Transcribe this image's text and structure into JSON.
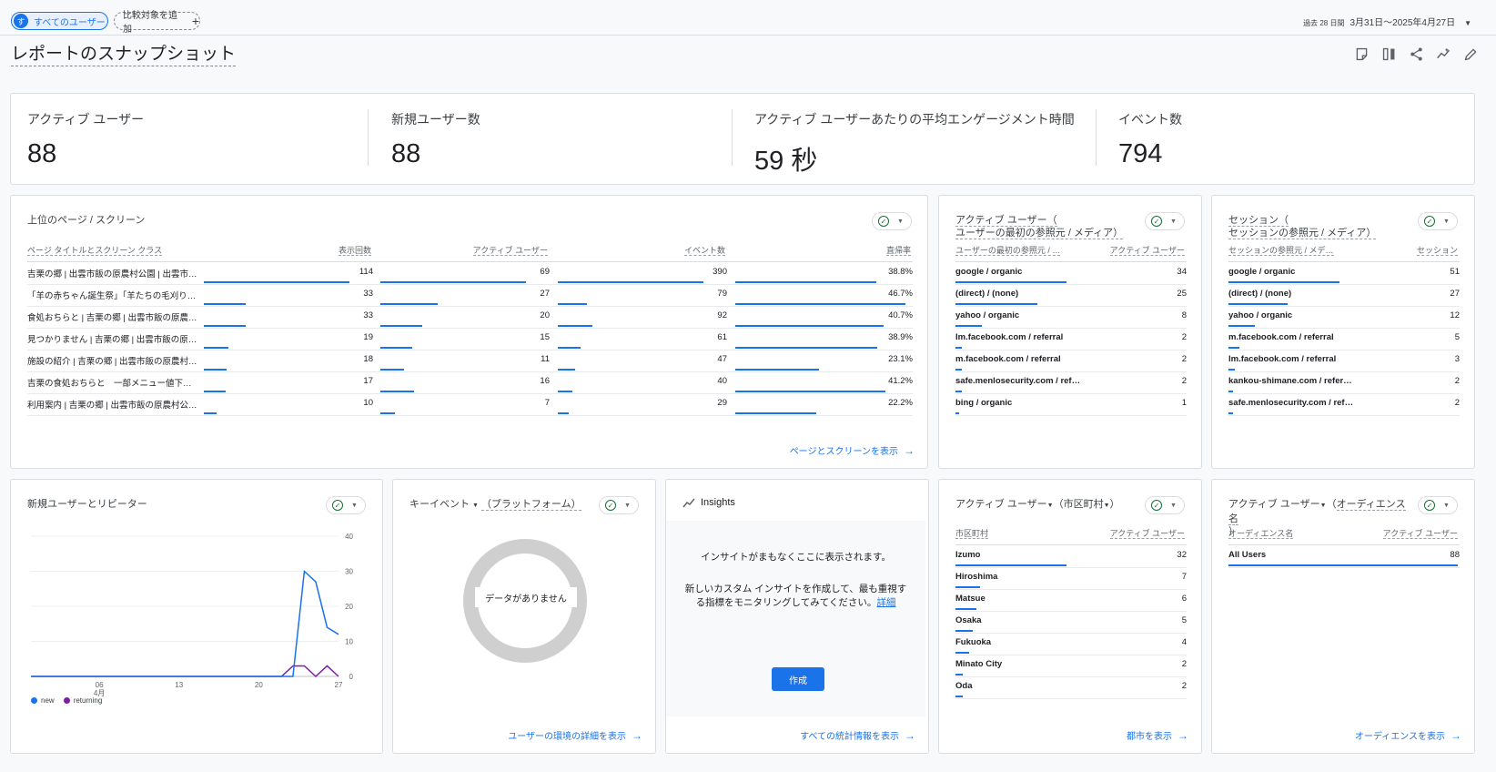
{
  "topbar": {
    "user_chip_avatar": "す",
    "user_chip_label": "すべてのユーザー",
    "add_compare_label": "比較対象を追加",
    "date_prefix": "過去 28 日間",
    "date_range": "3月31日～2025年4月27日",
    "date_caret": "▼"
  },
  "page": {
    "title": "レポートのスナップショット"
  },
  "kpis": [
    {
      "label": "アクティブ ユーザー",
      "value": "88"
    },
    {
      "label": "新規ユーザー数",
      "value": "88"
    },
    {
      "label": "アクティブ ユーザーあたりの平均エンゲージメント時間",
      "value": "59 秒"
    },
    {
      "label": "イベント数",
      "value": "794"
    }
  ],
  "pages_card": {
    "title": "上位のページ / スクリーン",
    "headers": [
      "ページ タイトルとスクリーン クラス",
      "表示回数",
      "アクティブ ユーザー",
      "イベント数",
      "直帰率"
    ],
    "rows": [
      {
        "name": "吉栗の郷 | 出雲市飯の原農村公園 | 出雲市…",
        "views": "114",
        "users": "69",
        "events": "390",
        "bounce": "38.8%",
        "v": 114,
        "u": 69,
        "e": 390,
        "b": 38.8
      },
      {
        "name": "「羊の赤ちゃん誕生祭」「羊たちの毛刈り…",
        "views": "33",
        "users": "27",
        "events": "79",
        "bounce": "46.7%",
        "v": 33,
        "u": 27,
        "e": 79,
        "b": 46.7
      },
      {
        "name": "食処おちらと | 吉栗の郷 | 出雲市飯の原農…",
        "views": "33",
        "users": "20",
        "events": "92",
        "bounce": "40.7%",
        "v": 33,
        "u": 20,
        "e": 92,
        "b": 40.7
      },
      {
        "name": "見つかりません | 吉栗の郷 | 出雲市飯の原…",
        "views": "19",
        "users": "15",
        "events": "61",
        "bounce": "38.9%",
        "v": 19,
        "u": 15,
        "e": 61,
        "b": 38.9
      },
      {
        "name": "施設の紹介 | 吉栗の郷 | 出雲市飯の原農村…",
        "views": "18",
        "users": "11",
        "events": "47",
        "bounce": "23.1%",
        "v": 18,
        "u": 11,
        "e": 47,
        "b": 23.1
      },
      {
        "name": "吉栗の食処おちらと　一部メニュー値下…",
        "views": "17",
        "users": "16",
        "events": "40",
        "bounce": "41.2%",
        "v": 17,
        "u": 16,
        "e": 40,
        "b": 41.2
      },
      {
        "name": "利用案内 | 吉栗の郷 | 出雲市飯の原農村公…",
        "views": "10",
        "users": "7",
        "events": "29",
        "bounce": "22.2%",
        "v": 10,
        "u": 7,
        "e": 29,
        "b": 22.2
      }
    ],
    "link": "ページとスクリーンを表示"
  },
  "source_card": {
    "title_line1": "アクティブ ユーザー（",
    "title_line2": "ユーザーの最初の参照元 / メディア）",
    "headers": [
      "ユーザーの最初の参照元 / …",
      "アクティブ ユーザー"
    ],
    "rows": [
      {
        "name": "google / organic",
        "value": "34",
        "n": 34
      },
      {
        "name": "(direct) / (none)",
        "value": "25",
        "n": 25
      },
      {
        "name": "yahoo / organic",
        "value": "8",
        "n": 8
      },
      {
        "name": "lm.facebook.com / referral",
        "value": "2",
        "n": 2
      },
      {
        "name": "m.facebook.com / referral",
        "value": "2",
        "n": 2
      },
      {
        "name": "safe.menlosecurity.com / ref…",
        "value": "2",
        "n": 2
      },
      {
        "name": "bing / organic",
        "value": "1",
        "n": 1
      }
    ]
  },
  "session_card": {
    "title_line1": "セッション（",
    "title_line2": "セッションの参照元 / メディア）",
    "headers": [
      "セッションの参照元 / メデ…",
      "セッション"
    ],
    "rows": [
      {
        "name": "google / organic",
        "value": "51",
        "n": 51
      },
      {
        "name": "(direct) / (none)",
        "value": "27",
        "n": 27
      },
      {
        "name": "yahoo / organic",
        "value": "12",
        "n": 12
      },
      {
        "name": "m.facebook.com / referral",
        "value": "5",
        "n": 5
      },
      {
        "name": "lm.facebook.com / referral",
        "value": "3",
        "n": 3
      },
      {
        "name": "kankou-shimane.com / refer…",
        "value": "2",
        "n": 2
      },
      {
        "name": "safe.menlosecurity.com / ref…",
        "value": "2",
        "n": 2
      }
    ]
  },
  "newret_card": {
    "title": "新規ユーザーとリピーター",
    "legend": [
      "new",
      "returning"
    ]
  },
  "chart_data": {
    "type": "line",
    "x_ticks": [
      "06",
      "13",
      "20",
      "27"
    ],
    "x_month": "4月",
    "y_ticks": [
      "0",
      "10",
      "20",
      "30",
      "40"
    ],
    "ylim": [
      0,
      40
    ],
    "x": [
      "3/31",
      "4/1",
      "4/2",
      "4/3",
      "4/4",
      "4/5",
      "4/6",
      "4/7",
      "4/8",
      "4/9",
      "4/10",
      "4/11",
      "4/12",
      "4/13",
      "4/14",
      "4/15",
      "4/16",
      "4/17",
      "4/18",
      "4/19",
      "4/20",
      "4/21",
      "4/22",
      "4/23",
      "4/24",
      "4/25",
      "4/26",
      "4/27"
    ],
    "series": [
      {
        "name": "new",
        "color": "#1a73e8",
        "values": [
          0,
          0,
          0,
          0,
          0,
          0,
          0,
          0,
          0,
          0,
          0,
          0,
          0,
          0,
          0,
          0,
          0,
          0,
          0,
          0,
          0,
          0,
          0,
          0,
          30,
          27,
          14,
          12
        ]
      },
      {
        "name": "returning",
        "color": "#7b1fa2",
        "values": [
          0,
          0,
          0,
          0,
          0,
          0,
          0,
          0,
          0,
          0,
          0,
          0,
          0,
          0,
          0,
          0,
          0,
          0,
          0,
          0,
          0,
          0,
          0,
          3,
          3,
          0,
          3,
          0
        ]
      }
    ],
    "grid": true,
    "legend": "bottom-left"
  },
  "keyevent_card": {
    "title_a": "キーイベント",
    "title_b": "（プラットフォーム）",
    "nodata": "データがありません",
    "link": "ユーザーの環境の詳細を表示"
  },
  "insights_card": {
    "title": "Insights",
    "msg1": "インサイトがまもなくここに表示されます。",
    "msg2a": "新しいカスタム インサイトを作成して、最も重視す",
    "msg2b": "る指標をモニタリングしてみてください。",
    "detail_link": "詳細",
    "create_btn": "作成",
    "link": "すべての統計情報を表示"
  },
  "city_card": {
    "title_a": "アクティブ ユーザー",
    "title_b": "（市区町村",
    "title_c": "）",
    "headers": [
      "市区町村",
      "アクティブ ユーザー"
    ],
    "rows": [
      {
        "name": "Izumo",
        "value": "32",
        "n": 32
      },
      {
        "name": "Hiroshima",
        "value": "7",
        "n": 7
      },
      {
        "name": "Matsue",
        "value": "6",
        "n": 6
      },
      {
        "name": "Osaka",
        "value": "5",
        "n": 5
      },
      {
        "name": "Fukuoka",
        "value": "4",
        "n": 4
      },
      {
        "name": "Minato City",
        "value": "2",
        "n": 2
      },
      {
        "name": "Oda",
        "value": "2",
        "n": 2
      }
    ],
    "link": "都市を表示"
  },
  "audience_card": {
    "title_a": "アクティブ ユーザー",
    "title_b": "（",
    "title_c": "オーディエンス名",
    "title_d": "）",
    "headers": [
      "オーディエンス名",
      "アクティブ ユーザー"
    ],
    "rows": [
      {
        "name": "All Users",
        "value": "88",
        "n": 88
      }
    ],
    "link": "オーディエンスを表示"
  },
  "colors": {
    "accent": "#1a73e8",
    "returning": "#7b1fa2",
    "ok": "#137333"
  }
}
